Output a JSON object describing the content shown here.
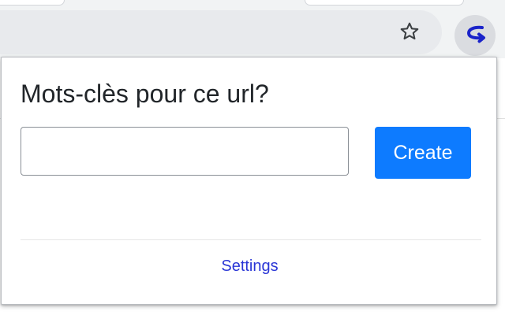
{
  "toolbar": {
    "bookmark_icon": "star-outline-icon",
    "extension_icon": "curved-arrow-icon",
    "extension_icon_color": "#1a23c9"
  },
  "popup": {
    "title": "Mots-clès pour ce url?",
    "keyword_input": {
      "value": "",
      "placeholder": ""
    },
    "create_label": "Create",
    "create_color": "#0d7bff",
    "settings_label": "Settings",
    "settings_color": "#2a36d6"
  }
}
